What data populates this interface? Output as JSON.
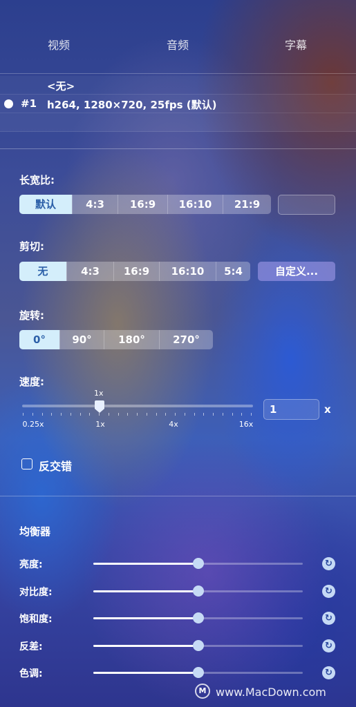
{
  "tabs": [
    {
      "label": "视频"
    },
    {
      "label": "音频"
    },
    {
      "label": "字幕"
    }
  ],
  "tracks": [
    {
      "id": "",
      "text": "<无>",
      "selected": false
    },
    {
      "id": "#1",
      "text": "h264, 1280×720, 25fps (默认)",
      "selected": true
    }
  ],
  "aspect": {
    "label": "长宽比:",
    "options": [
      "默认",
      "4:3",
      "16:9",
      "16:10",
      "21:9"
    ],
    "selected": "默认",
    "custom_value": ""
  },
  "crop": {
    "label": "剪切:",
    "options": [
      "无",
      "4:3",
      "16:9",
      "16:10",
      "5:4"
    ],
    "selected": "无",
    "custom_button": "自定义..."
  },
  "rotation": {
    "label": "旋转:",
    "options": [
      "0°",
      "90°",
      "180°",
      "270°"
    ],
    "selected": "0°"
  },
  "speed": {
    "label": "速度:",
    "current_label": "1x",
    "value": "1",
    "unit": "x",
    "tick_labels": [
      "0.25x",
      "1x",
      "4x",
      "16x"
    ]
  },
  "deinterlace": {
    "label": "反交错",
    "checked": false
  },
  "equalizer": {
    "title": "均衡器",
    "items": [
      {
        "label": "亮度:",
        "value": 0.5
      },
      {
        "label": "对比度:",
        "value": 0.5
      },
      {
        "label": "饱和度:",
        "value": 0.5
      },
      {
        "label": "反差:",
        "value": 0.5
      },
      {
        "label": "色调:",
        "value": 0.5
      }
    ]
  },
  "watermark": {
    "text": "www.MacDown.com"
  }
}
